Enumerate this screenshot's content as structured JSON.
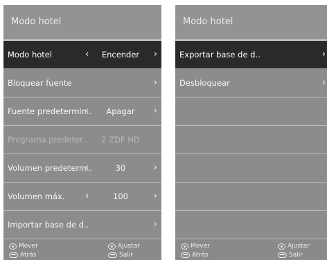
{
  "left_panel": {
    "title": "Modo hotel",
    "rows": [
      {
        "label": "Modo hotel",
        "value": "Encender",
        "has_arrows": true,
        "selected": true
      },
      {
        "label": "Bloquear fuente",
        "value": "",
        "has_arrows": false
      },
      {
        "label": "Fuente predetermin..",
        "value": "Apagar",
        "has_arrows": true
      },
      {
        "label": "Programa predeter..",
        "value": "2 ZDF HD",
        "has_arrows": false,
        "disabled": true
      },
      {
        "label": "Volumen predeterm..",
        "value": "30",
        "has_arrows": true
      },
      {
        "label": "Volumen máx.",
        "value": "100",
        "has_arrows": true
      },
      {
        "label": "Importar base de d..",
        "value": "",
        "has_arrows": false
      }
    ],
    "footer": {
      "move": "Mover",
      "adjust": "Ajustar",
      "back": "Atrás",
      "exit": "Salir"
    }
  },
  "right_panel": {
    "title": "Modo hotel",
    "rows": [
      {
        "label": "Exportar base de d..",
        "selected": true
      },
      {
        "label": "Desbloquear"
      }
    ],
    "footer": {
      "move": "Mover",
      "adjust": "Ajustar",
      "back": "Atrás",
      "exit": "Salir"
    }
  },
  "icons": {
    "left_arrow": "‹",
    "right_arrow": "›"
  }
}
